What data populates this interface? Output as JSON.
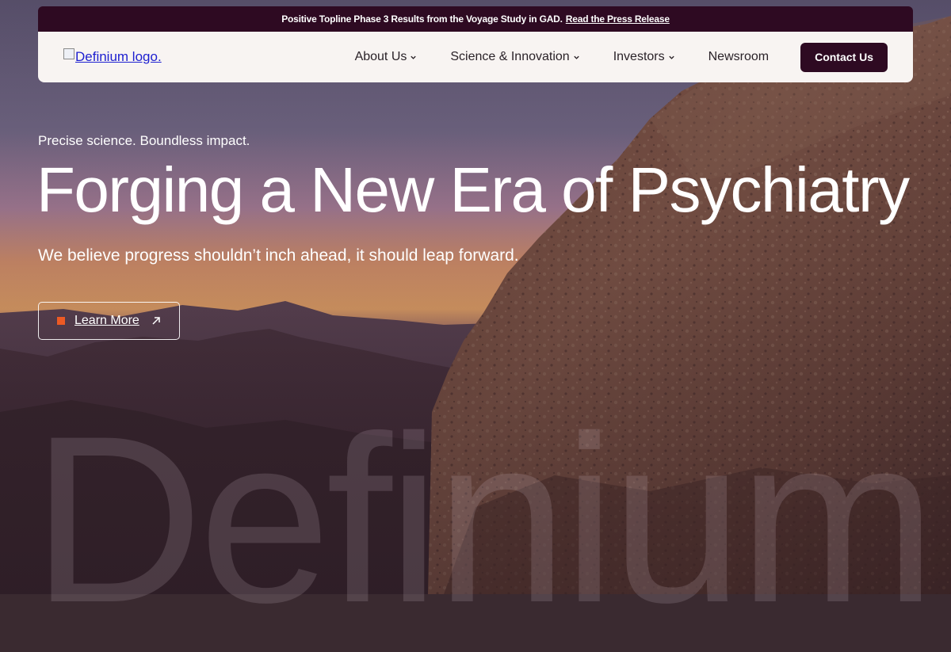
{
  "announcement": {
    "text": "Positive Topline Phase 3 Results from the Voyage Study in GAD.",
    "link": "Read the Press Release"
  },
  "header": {
    "logo_alt": "Definium logo.",
    "nav": [
      {
        "label": "About Us",
        "icon": "chevron-down-icon"
      },
      {
        "label": "Science & Innovation",
        "icon": "chevron-down-icon"
      },
      {
        "label": "Investors",
        "icon": "chevron-down-icon"
      },
      {
        "label": "Newsroom"
      }
    ],
    "contact_label": "Contact Us"
  },
  "hero": {
    "tagline": "Precise science. Boundless impact.",
    "headline": "Forging a New Era of Psychiatry",
    "subline": "We believe progress shouldn’t inch ahead, it should leap forward.",
    "cta_label": "Learn More"
  },
  "watermark": "Definium",
  "colors": {
    "brand_dark": "#2e0a22",
    "accent": "#ec5a24",
    "nav_bg": "#f8f4f2"
  }
}
